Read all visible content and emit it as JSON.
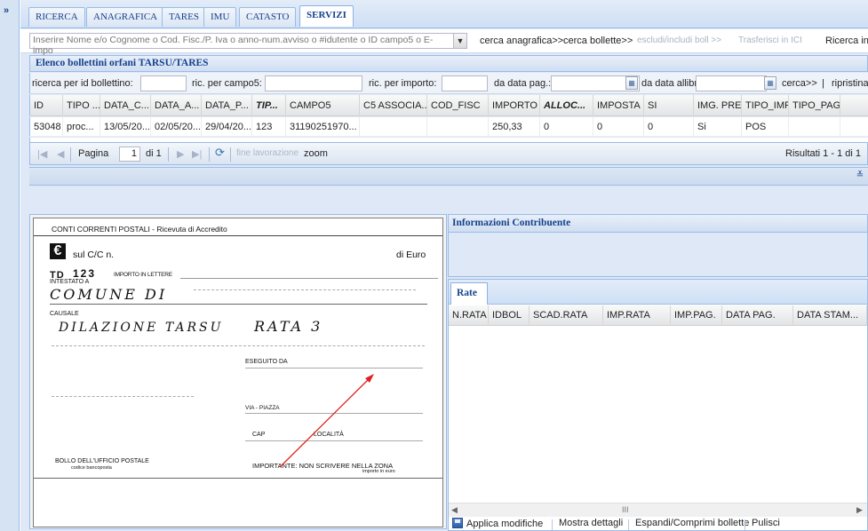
{
  "sidebar": {
    "expand_label": "»"
  },
  "tabs": [
    {
      "label": "RICERCA"
    },
    {
      "label": "ANAGRAFICA"
    },
    {
      "label": "TARES"
    },
    {
      "label": "IMU"
    },
    {
      "label": "CATASTO"
    },
    {
      "label": "SERVIZI",
      "active": true
    }
  ],
  "search": {
    "placeholder": "Inserire Nome e/o Cognome o Cod. Fisc./P. Iva o anno-num.avviso o #idutente o ID campo5 o E-impo",
    "buttons": [
      "cerca anagrafica>>",
      "cerca bollette>>",
      "escludi/includi boll >>",
      "Trasferisci in ICI",
      "Ricerca in"
    ]
  },
  "grid": {
    "title": "Elenco bollettini orfani TARSU/TARES",
    "filters": {
      "id_label": "ricerca per id bollettino:",
      "campo5_label": "ric. per campo5:",
      "importo_label": "ric. per importo:",
      "data_pag_label": "da data pag.:",
      "data_allibr_label": "da data allibr.:",
      "cerca_label": "cerca>>",
      "sep": "|",
      "ripristina_label": "ripristina filtri"
    },
    "columns": [
      "ID",
      "TIPO ...",
      "DATA_C...",
      "DATA_A...",
      "DATA_P...",
      "TIP...",
      "CAMPO5",
      "C5 ASSOCIA...",
      "COD_FISC",
      "IMPORTO",
      "ALLOC...",
      "IMPOSTA",
      "SI",
      "IMG. PRE...",
      "TIPO_IMP...",
      "TIPO_PAG"
    ],
    "rows": [
      [
        "53048",
        "proc...",
        "13/05/20...",
        "02/05/20...",
        "29/04/20...",
        "123",
        "31190251970...",
        "",
        "",
        "250,33",
        "0",
        "0",
        "0",
        "Si",
        "POS",
        ""
      ]
    ]
  },
  "pager": {
    "page_label": "Pagina",
    "page_value": "1",
    "of_label": "di 1",
    "fine_label": "fine lavorazione",
    "zoom_label": "zoom",
    "results_label": "Risultati 1 - 1 di 1"
  },
  "receipt": {
    "header": "CONTI CORRENTI POSTALI - Ricevuta di Accredito",
    "euro_symbol": "€",
    "sul_cc": "sul C/C n.",
    "di_euro": "di Euro",
    "td": "TD",
    "td_number": "123",
    "importo_lettere": "IMPORTO IN LETTERE",
    "intestato": "INTESTATO A",
    "intestato_hand": "COMUNE DI",
    "causale": "CAUSALE",
    "causale_hand": "DILAZIONE TARSU",
    "rata_hand": "RATA 3",
    "eseguito": "ESEGUITO DA",
    "via": "VIA - PIAZZA",
    "cap": "CAP",
    "localita": "LOCALITÀ",
    "bollo": "BOLLO DELL'UFFICIO POSTALE",
    "codice": "codice bancoposta",
    "importante": "IMPORTANTE: NON SCRIVERE NELLA ZONA",
    "importo_euro": "importo in euro",
    "arrow_color": "#e02020"
  },
  "info": {
    "title": "Informazioni Contribuente"
  },
  "rate": {
    "tab": "Rate",
    "columns": [
      "N.RATA",
      "IDBOL",
      "SCAD.RATA",
      "IMP.RATA",
      "IMP.PAG.",
      "DATA PAG.",
      "DATA STAM..."
    ],
    "scroll_grip": "III",
    "buttons": [
      "Applica modifiche",
      "Mostra dettagli",
      "Espandi/Comprimi bollette",
      "Pulisci"
    ]
  },
  "colors": {
    "accent": "#15428b",
    "border": "#99bbe8",
    "panel_bg": "#dfe8f6"
  }
}
